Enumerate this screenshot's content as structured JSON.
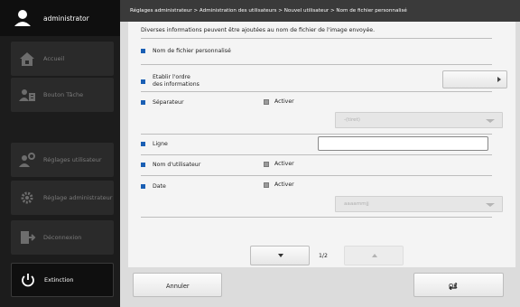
{
  "sidebar": {
    "user": "administrator",
    "items": [
      {
        "label": "Accueil"
      },
      {
        "label": "Bouton Tâche"
      },
      {
        "label": "Réglages utilisateur"
      },
      {
        "label": "Réglage administrateur"
      },
      {
        "label": "Déconnexion"
      },
      {
        "label": "Extinction"
      }
    ]
  },
  "breadcrumb": "Réglages administrateur > Administration des utilisateurs > Nouvel utilisateur > Nom de fichier personnalisé",
  "form": {
    "description": "Diverses informations peuvent être ajoutées au nom de fichier de l'image envoyée.",
    "custom_filename_label": "Nom de fichier personnalisé",
    "order_label_line1": "Etablir l'ordre",
    "order_label_line2": "des informations",
    "separator_label": "Séparateur",
    "separator_enable": "Activer",
    "separator_select": "-(tiret)",
    "line_label": "Ligne",
    "line_value": "",
    "username_label": "Nom d'utilisateur",
    "username_enable": "Activer",
    "date_label": "Date",
    "date_enable": "Activer",
    "date_select": "aaaammjj"
  },
  "pager": {
    "page": "1/2"
  },
  "buttons": {
    "cancel": "Annuler",
    "ok": "OK"
  },
  "colors": {
    "accent": "#1a5fb4",
    "sidebar": "#1c1c1c"
  }
}
